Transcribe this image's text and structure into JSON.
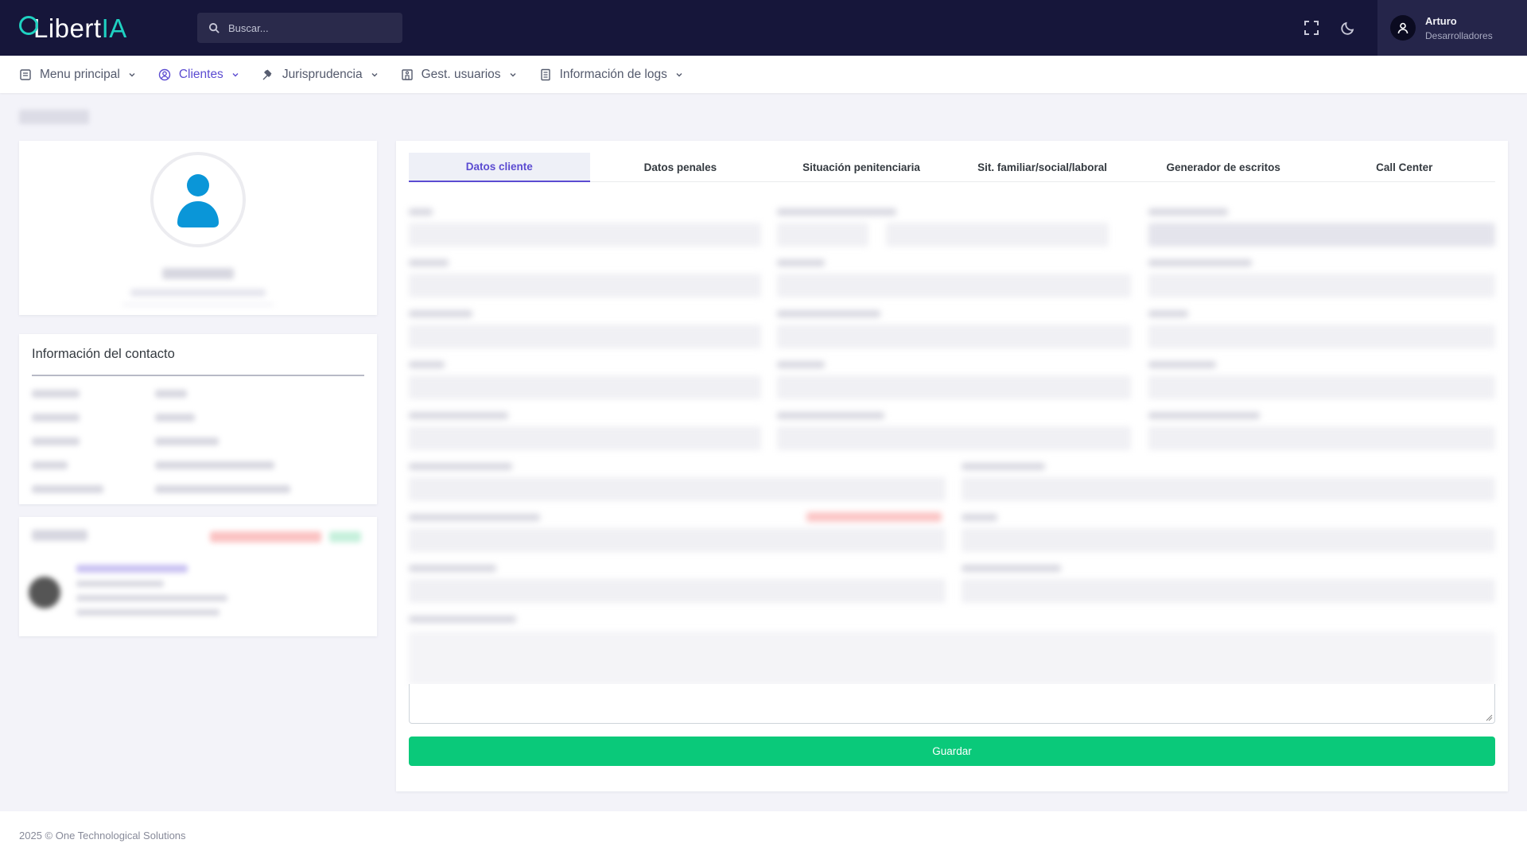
{
  "header": {
    "logo_part1": "Libert",
    "logo_part2": "IA",
    "search_placeholder": "Buscar...",
    "user_name": "Arturo",
    "user_role": "Desarrolladores"
  },
  "nav": {
    "items": [
      {
        "label": "Menu principal",
        "icon": "document-icon"
      },
      {
        "label": "Clientes",
        "icon": "user-circle-icon",
        "active": true
      },
      {
        "label": "Jurisprudencia",
        "icon": "gavel-icon"
      },
      {
        "label": "Gest. usuarios",
        "icon": "building-icon"
      },
      {
        "label": "Información de logs",
        "icon": "file-text-icon"
      }
    ]
  },
  "contact": {
    "title": "Información del contacto"
  },
  "tabs": [
    {
      "label": "Datos cliente",
      "active": true
    },
    {
      "label": "Datos penales"
    },
    {
      "label": "Situación penitenciaria"
    },
    {
      "label": "Sit. familiar/social/laboral"
    },
    {
      "label": "Generador de escritos"
    },
    {
      "label": "Call Center"
    }
  ],
  "form": {
    "save_label": "Guardar"
  },
  "footer": {
    "text": "2025 © One Technological Solutions"
  },
  "colors": {
    "topbar": "#16163a",
    "accent": "#5b4bd1",
    "brand_teal": "#1fd1c1",
    "success": "#0ac97a",
    "avatar_blue": "#0a96d8"
  }
}
